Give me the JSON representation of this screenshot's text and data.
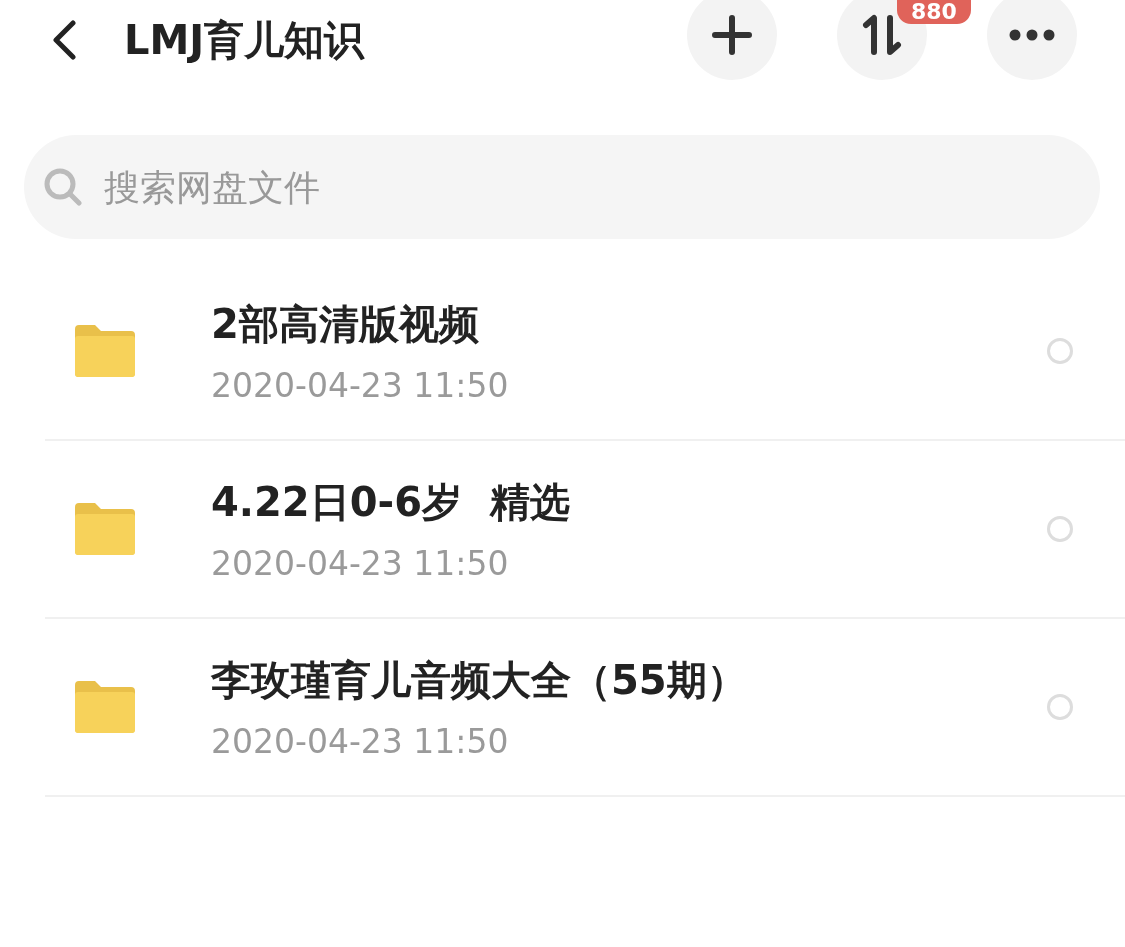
{
  "header": {
    "title": "LMJ育儿知识",
    "transfer_badge": "880"
  },
  "search": {
    "placeholder": "搜索网盘文件"
  },
  "files": [
    {
      "kind": "folder",
      "name": "2部高清版视频",
      "date": "2020-04-23 11:50",
      "selected": false
    },
    {
      "kind": "folder",
      "name": "4.22日0-6岁  精选",
      "date": "2020-04-23 11:50",
      "selected": false
    },
    {
      "kind": "folder",
      "name": "李玫瑾育儿音频大全（55期）",
      "date": "2020-04-23 11:50",
      "selected": false
    }
  ]
}
